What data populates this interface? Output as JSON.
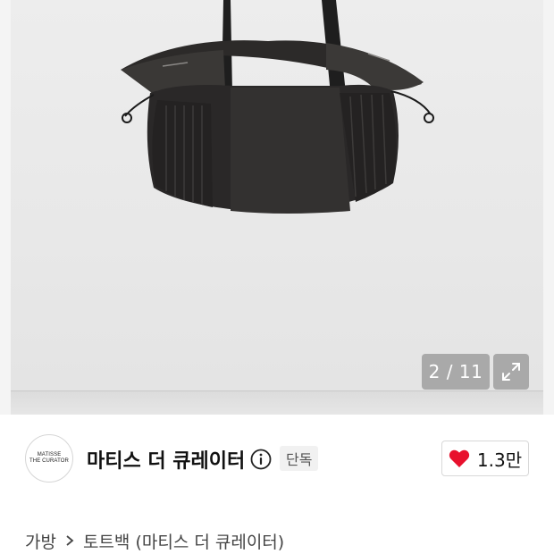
{
  "gallery": {
    "counter_text": "2 / 11",
    "expand_icon": "expand-arrows-icon"
  },
  "seller": {
    "logo_line1": "MATISSE",
    "logo_line2": "THE CURATOR",
    "name": "마티스 더 큐레이터",
    "info_icon": "info-circle-icon",
    "badge": "단독"
  },
  "like": {
    "icon": "heart-icon",
    "count": "1.3만",
    "color": "#e8112d"
  },
  "breadcrumb": {
    "category": "가방",
    "separator_icon": "chevron-right-icon",
    "subcategory": "토트백 (마티스 더 큐레이터)"
  }
}
